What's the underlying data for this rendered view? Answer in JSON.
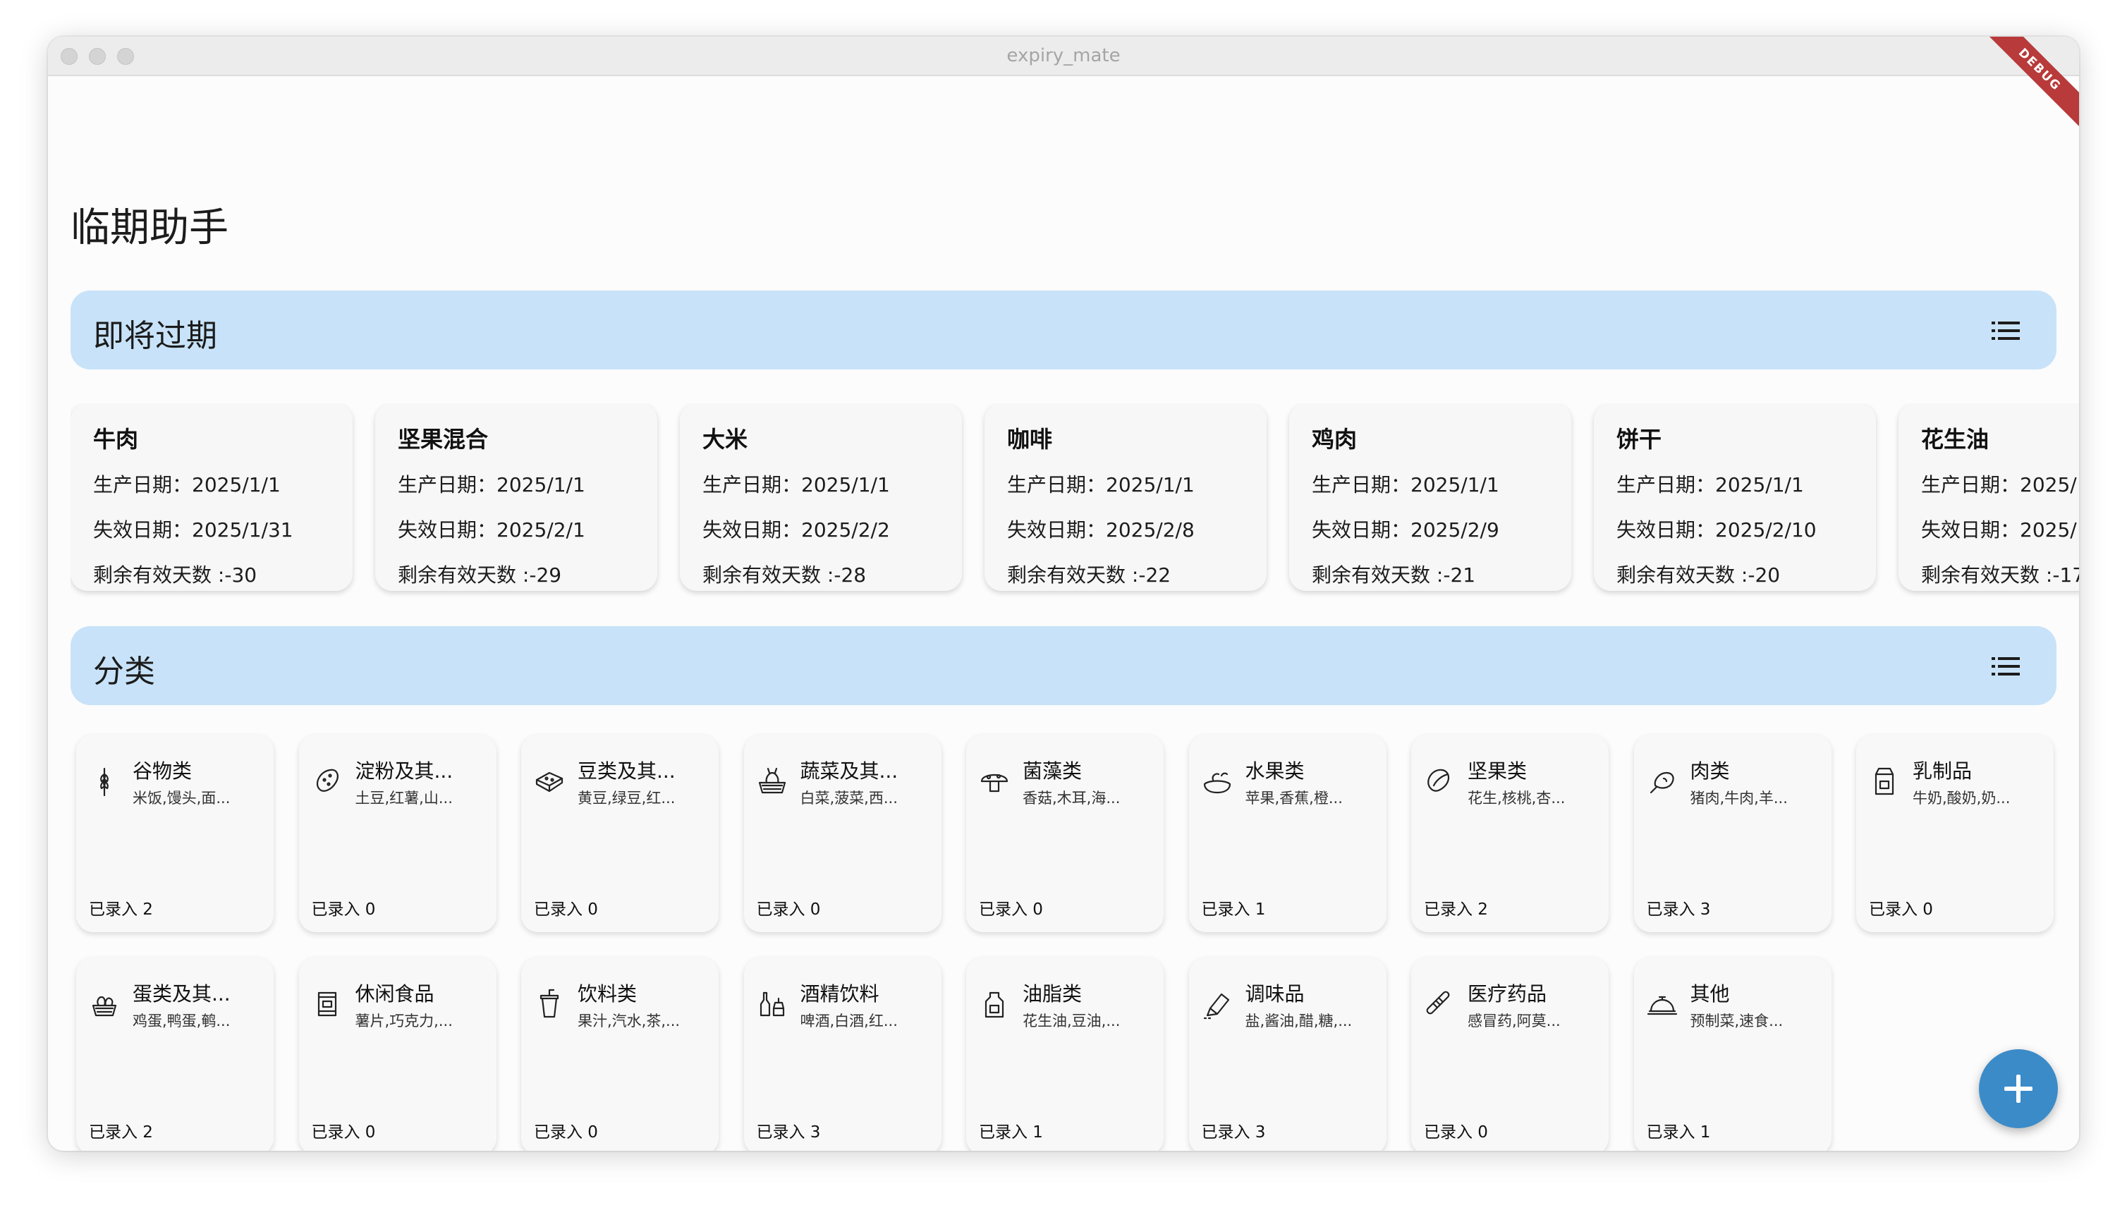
{
  "window": {
    "title": "expiry_mate",
    "debug_banner": "DEBUG"
  },
  "app": {
    "title": "临期助手"
  },
  "expiring_section": {
    "title": "即将过期"
  },
  "category_section": {
    "title": "分类"
  },
  "expiring_items": [
    {
      "name": "牛肉",
      "production": "生产日期：2025/1/1",
      "expiry": "失效日期：2025/1/31",
      "remaining": "剩余有效天数 :-30"
    },
    {
      "name": "坚果混合",
      "production": "生产日期：2025/1/1",
      "expiry": "失效日期：2025/2/1",
      "remaining": "剩余有效天数 :-29"
    },
    {
      "name": "大米",
      "production": "生产日期：2025/1/1",
      "expiry": "失效日期：2025/2/2",
      "remaining": "剩余有效天数 :-28"
    },
    {
      "name": "咖啡",
      "production": "生产日期：2025/1/1",
      "expiry": "失效日期：2025/2/8",
      "remaining": "剩余有效天数 :-22"
    },
    {
      "name": "鸡肉",
      "production": "生产日期：2025/1/1",
      "expiry": "失效日期：2025/2/9",
      "remaining": "剩余有效天数 :-21"
    },
    {
      "name": "饼干",
      "production": "生产日期：2025/1/1",
      "expiry": "失效日期：2025/2/10",
      "remaining": "剩余有效天数 :-20"
    },
    {
      "name": "花生油",
      "production": "生产日期：2025/",
      "expiry": "失效日期：2025/",
      "remaining": "剩余有效天数 :-17"
    }
  ],
  "categories": [
    {
      "name": "谷物类",
      "desc": "米饭,馒头,面...",
      "count": "已录入 2",
      "icon": "wheat-icon"
    },
    {
      "name": "淀粉及其...",
      "desc": "土豆,红薯,山...",
      "count": "已录入 0",
      "icon": "potato-icon"
    },
    {
      "name": "豆类及其...",
      "desc": "黄豆,绿豆,红...",
      "count": "已录入 0",
      "icon": "tofu-icon"
    },
    {
      "name": "蔬菜及其...",
      "desc": "白菜,菠菜,西...",
      "count": "已录入 0",
      "icon": "vegetable-basket-icon"
    },
    {
      "name": "菌藻类",
      "desc": "香菇,木耳,海...",
      "count": "已录入 0",
      "icon": "mushroom-icon"
    },
    {
      "name": "水果类",
      "desc": "苹果,香蕉,橙...",
      "count": "已录入 1",
      "icon": "fruit-icon"
    },
    {
      "name": "坚果类",
      "desc": "花生,核桃,杏...",
      "count": "已录入 2",
      "icon": "nut-icon"
    },
    {
      "name": "肉类",
      "desc": "猪肉,牛肉,羊...",
      "count": "已录入 3",
      "icon": "meat-icon"
    },
    {
      "name": "乳制品",
      "desc": "牛奶,酸奶,奶...",
      "count": "已录入 0",
      "icon": "milk-carton-icon"
    },
    {
      "name": "蛋类及其...",
      "desc": "鸡蛋,鸭蛋,鹌...",
      "count": "已录入 2",
      "icon": "egg-basket-icon"
    },
    {
      "name": "休闲食品",
      "desc": "薯片,巧克力,...",
      "count": "已录入 0",
      "icon": "snack-icon"
    },
    {
      "name": "饮料类",
      "desc": "果汁,汽水,茶,...",
      "count": "已录入 0",
      "icon": "drink-cup-icon"
    },
    {
      "name": "酒精饮料",
      "desc": "啤酒,白酒,红...",
      "count": "已录入 3",
      "icon": "liquor-bottle-icon"
    },
    {
      "name": "油脂类",
      "desc": "花生油,豆油,...",
      "count": "已录入 1",
      "icon": "oil-bottle-icon"
    },
    {
      "name": "调味品",
      "desc": "盐,酱油,醋,糖,...",
      "count": "已录入 3",
      "icon": "salt-shaker-icon"
    },
    {
      "name": "医疗药品",
      "desc": "感冒药,阿莫...",
      "count": "已录入 0",
      "icon": "bandage-icon"
    },
    {
      "name": "其他",
      "desc": "预制菜,速食...",
      "count": "已录入 1",
      "icon": "food-cloche-icon"
    }
  ],
  "fab": {
    "icon": "plus-icon"
  }
}
